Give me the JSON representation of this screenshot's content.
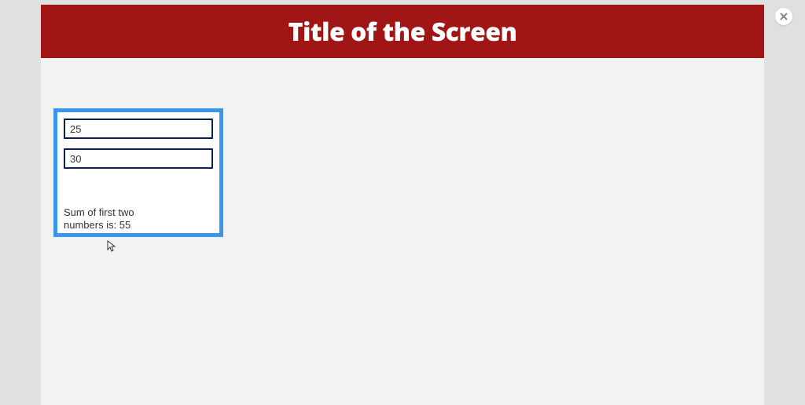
{
  "header": {
    "title": "Title of the Screen"
  },
  "widget": {
    "input1_value": "25",
    "input2_value": "30",
    "result_text": "Sum of first two numbers is: 55"
  }
}
